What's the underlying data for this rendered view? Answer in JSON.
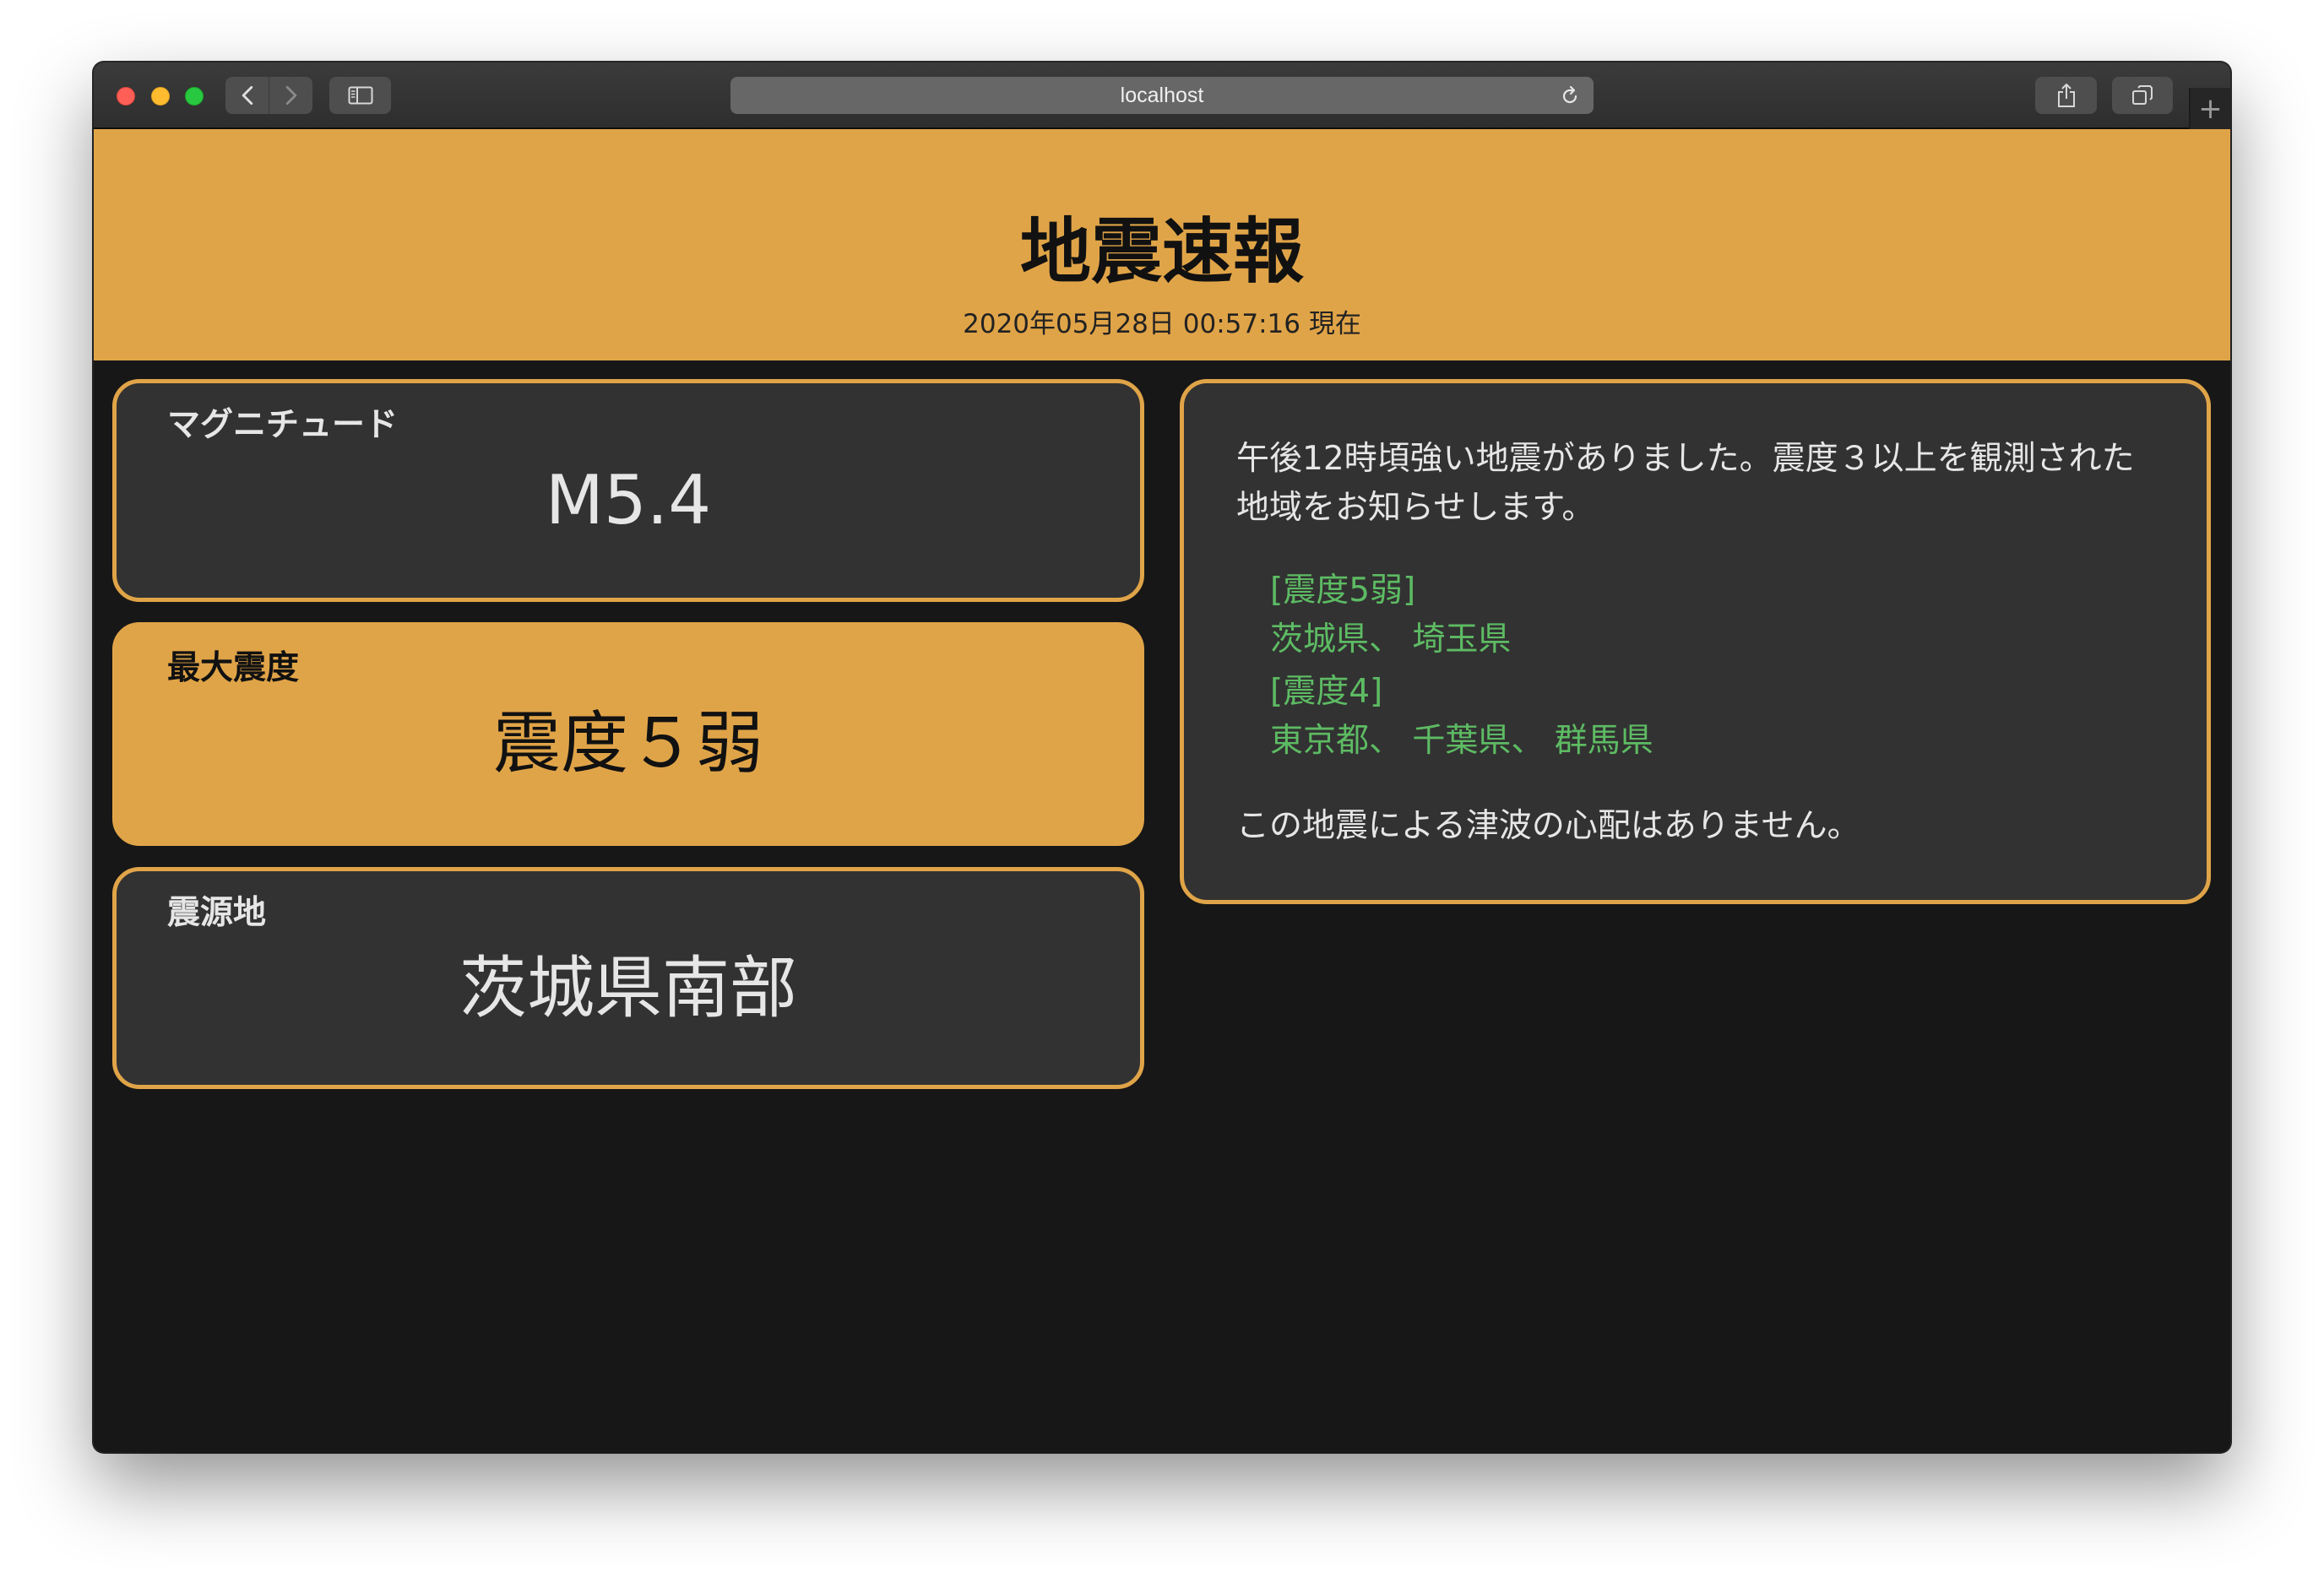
{
  "browser": {
    "address": "localhost",
    "icons": {
      "close": "close-icon",
      "minimize": "minimize-icon",
      "zoom": "zoom-icon",
      "back": "chevron-left-icon",
      "forward": "chevron-right-icon",
      "sidebar": "sidebar-icon",
      "reload": "reload-icon",
      "share": "share-icon",
      "tabs": "tabs-overview-icon",
      "new_tab": "plus-icon"
    },
    "new_tab_glyph": "+"
  },
  "colors": {
    "accent": "#E0A448",
    "page_background": "#171717",
    "card_background": "#323232",
    "region_text": "#5DBB63",
    "text": "#e6e6e6"
  },
  "header": {
    "title": "地震速報",
    "timestamp": "2020年05月28日 00:57:16 現在"
  },
  "cards": [
    {
      "label": "マグニチュード",
      "value": "M5.4",
      "highlighted": false
    },
    {
      "label": "最大震度",
      "value": "震度５弱",
      "highlighted": true
    },
    {
      "label": "震源地",
      "value": "茨城県南部",
      "highlighted": false
    }
  ],
  "message": {
    "intro_lines": [
      "午後12時頃強い地震がありました。震度３以上を観測された",
      "地域をお知らせします。"
    ],
    "intensity_groups": [
      {
        "heading": "[震度5弱]",
        "regions": "茨城県、 埼玉県"
      },
      {
        "heading": "[震度4]",
        "regions": "東京都、 千葉県、 群馬県"
      }
    ],
    "footer": "この地震による津波の心配はありません。"
  }
}
